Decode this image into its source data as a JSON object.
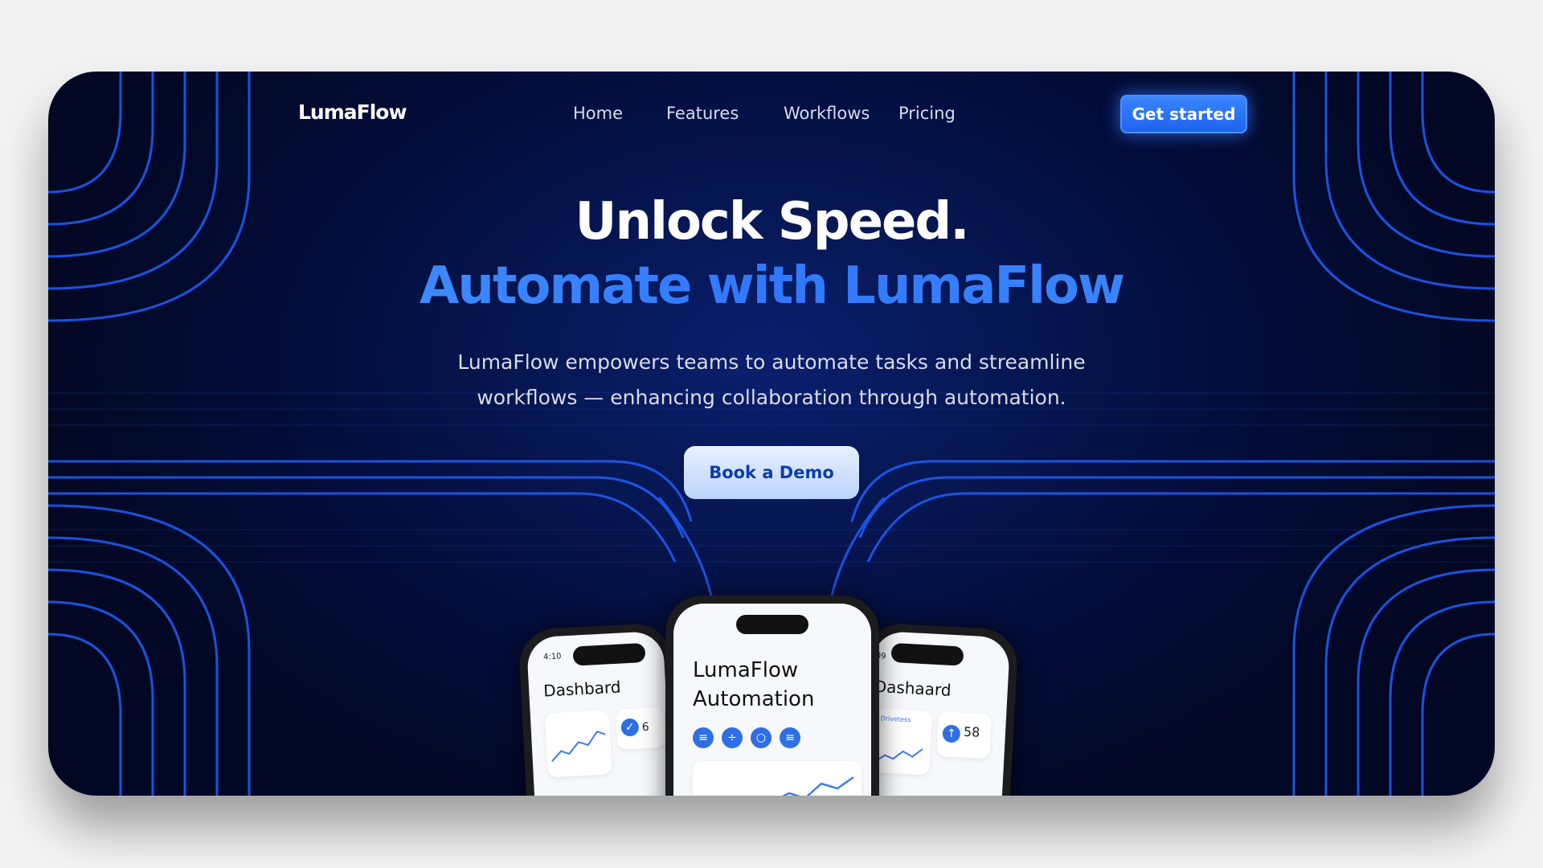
{
  "brand": {
    "name": "LumaFlow"
  },
  "nav": {
    "items": [
      "Home",
      "Features",
      "Workflows",
      "Pricing"
    ],
    "cta": "Get started"
  },
  "hero": {
    "title_line1": "Unlock Speed.",
    "title_line2": "Automate with LumaFlow",
    "subtitle_line1": "LumaFlow empowers teams to automate tasks and streamline",
    "subtitle_line2": "workflows — enhancing collaboration through automation.",
    "button": "Book a Demo"
  },
  "phones": {
    "left": {
      "time": "4:10",
      "title": "Dashbard",
      "stat": "6"
    },
    "center": {
      "title_line1": "LumaFlow",
      "title_line2": "Automation"
    },
    "right": {
      "time": "09",
      "title": "Dashaard",
      "stat": "58",
      "tag": "Drivetess"
    }
  },
  "colors": {
    "accent": "#2f78ff",
    "background": "#030c38"
  }
}
